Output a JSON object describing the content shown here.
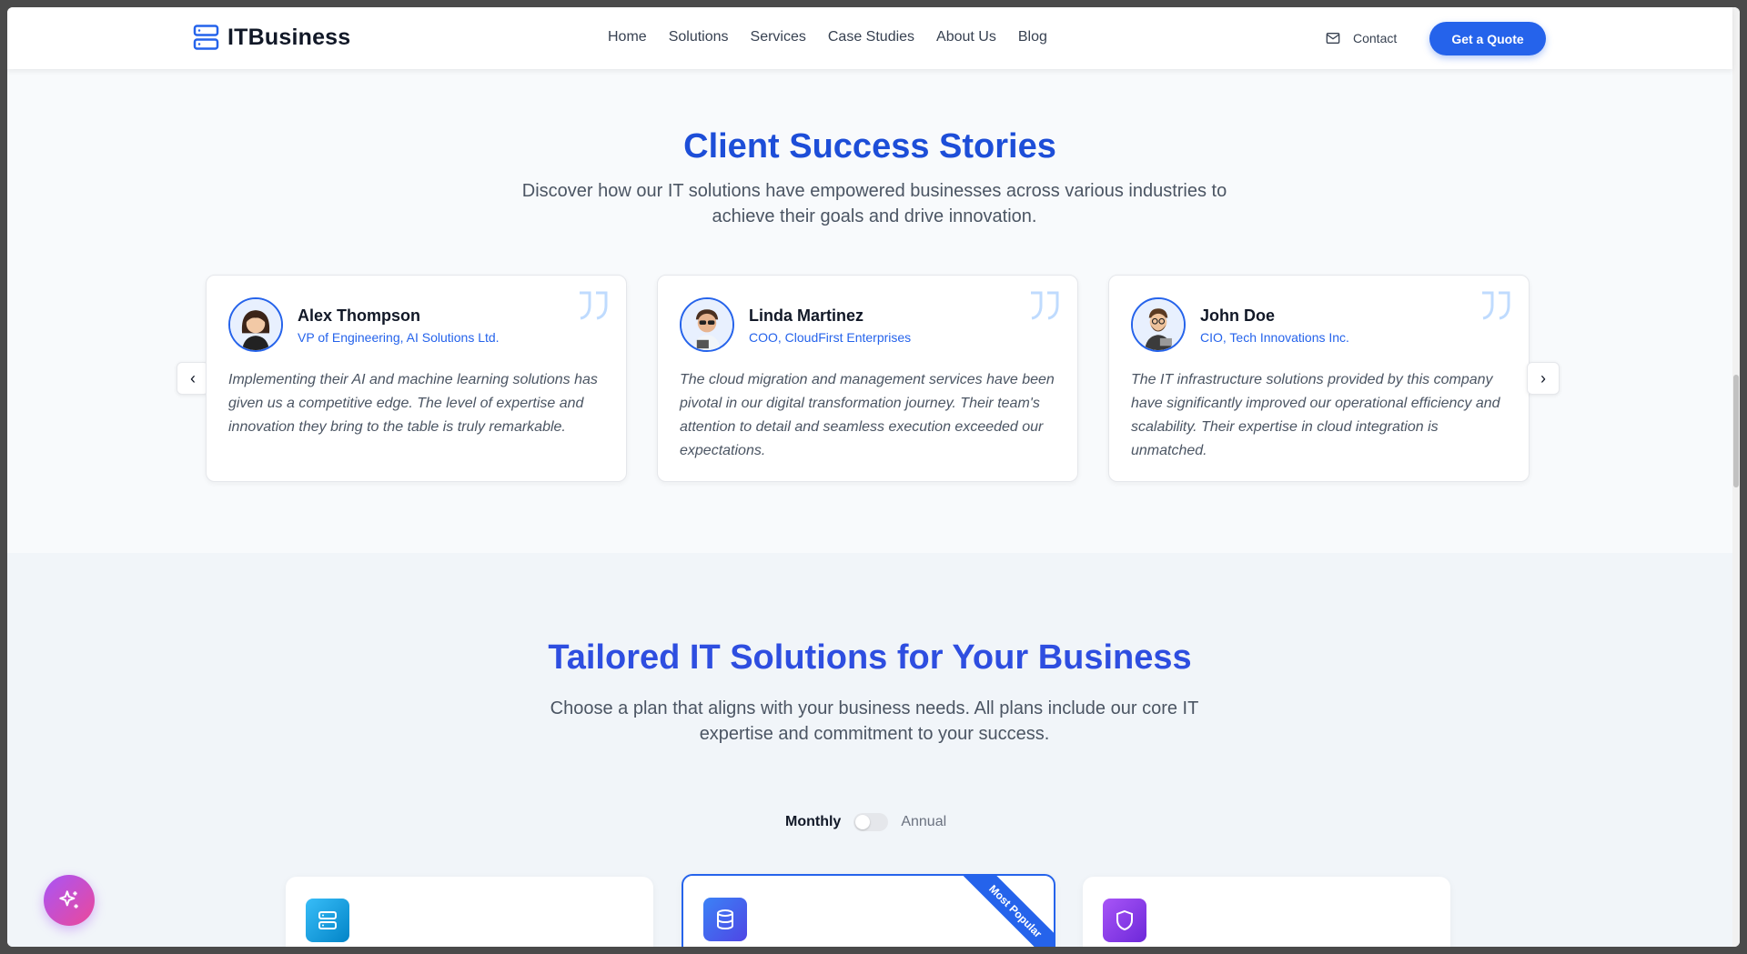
{
  "brand": {
    "name": "ITBusiness",
    "icon": "server-icon",
    "color": "#2563eb"
  },
  "nav": {
    "items": [
      "Home",
      "Solutions",
      "Services",
      "Case Studies",
      "About Us",
      "Blog"
    ],
    "contact_label": "Contact",
    "contact_icon": "mail-icon",
    "quote_button": "Get a Quote"
  },
  "testimonials": {
    "title": "Client Success Stories",
    "subtitle": "Discover how our IT solutions have empowered businesses across various industries to achieve their goals and drive innovation.",
    "cards": [
      {
        "name": "Alex Thompson",
        "role": "VP of Engineering, AI Solutions Ltd.",
        "text": "Implementing their AI and machine learning solutions has given us a competitive edge. The level of expertise and innovation they bring to the table is truly remarkable."
      },
      {
        "name": "Linda Martinez",
        "role": "COO, CloudFirst Enterprises",
        "text": "The cloud migration and management services have been pivotal in our digital transformation journey. Their team's attention to detail and seamless execution exceeded our expectations."
      },
      {
        "name": "John Doe",
        "role": "CIO, Tech Innovations Inc.",
        "text": "The IT infrastructure solutions provided by this company have significantly improved our operational efficiency and scalability. Their expertise in cloud integration is unmatched."
      }
    ],
    "prev_icon": "chevron-left-icon",
    "next_icon": "chevron-right-icon"
  },
  "pricing": {
    "title": "Tailored IT Solutions for Your Business",
    "subtitle": "Choose a plan that aligns with your business needs. All plans include our core IT expertise and commitment to your success.",
    "toggle": {
      "monthly": "Monthly",
      "annual": "Annual",
      "selected": "Monthly"
    },
    "plans": [
      {
        "icon": "server-icon",
        "color": "#0ea5e9"
      },
      {
        "icon": "database-icon",
        "color": "#2563eb",
        "badge": "Most Popular"
      },
      {
        "icon": "shield-icon",
        "color": "#7c3aed"
      }
    ]
  },
  "fab_icon": "sparkles-icon"
}
